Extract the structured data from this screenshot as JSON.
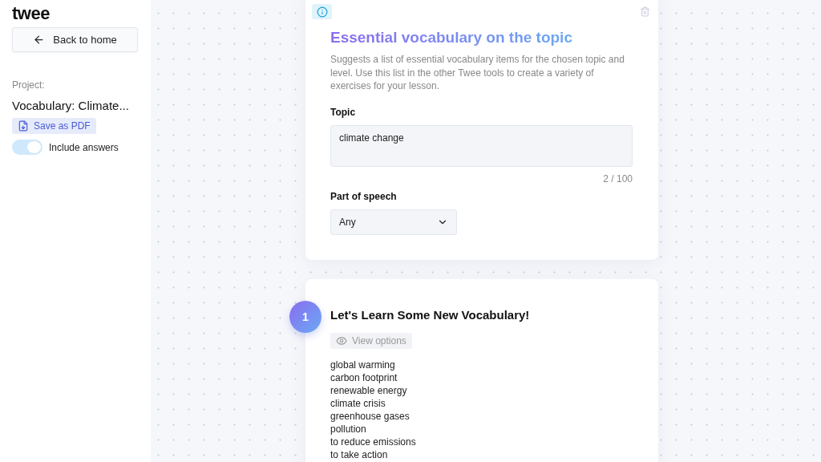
{
  "sidebar": {
    "logo": "twee",
    "back_button": "Back to home",
    "project_label": "Project:",
    "project_name": "Vocabulary: Climate...",
    "save_button": "Save as PDF",
    "include_answers": {
      "label": "Include answers",
      "on": true
    }
  },
  "tool_card": {
    "title": "Essential vocabulary on the topic",
    "description": "Suggests a list of essential vocabulary items for the chosen topic and level. Use this list in the other Twee tools to create a variety of exercises for your lesson.",
    "topic": {
      "label": "Topic",
      "value": "climate change",
      "counter": "2 / 100"
    },
    "part_of_speech": {
      "label": "Part of speech",
      "value": "Any"
    }
  },
  "result_card": {
    "number": "1",
    "title": "Let's Learn Some New Vocabulary!",
    "view_options": "View options",
    "items": [
      "global warming",
      "carbon footprint",
      "renewable energy",
      "climate crisis",
      "greenhouse gases",
      "pollution",
      "to reduce emissions",
      "to take action"
    ]
  }
}
